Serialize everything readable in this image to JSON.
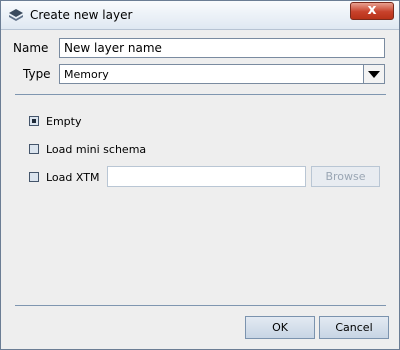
{
  "window": {
    "title": "Create new layer",
    "close_label": "x"
  },
  "form": {
    "name_label": "Name",
    "name_value": "New layer name",
    "type_label": "Type",
    "type_selected": "Memory"
  },
  "options": [
    {
      "label": "Empty",
      "checked": true
    },
    {
      "label": "Load mini schema",
      "checked": false
    },
    {
      "label": "Load XTM",
      "checked": false
    }
  ],
  "xtm": {
    "path_value": "",
    "browse_label": "Browse"
  },
  "footer": {
    "ok_label": "OK",
    "cancel_label": "Cancel"
  },
  "colors": {
    "title_gradient_top": "#f9fbfd",
    "close_button": "#c7412b",
    "separator": "#7f96b0",
    "button_face": "#d3dfec"
  }
}
